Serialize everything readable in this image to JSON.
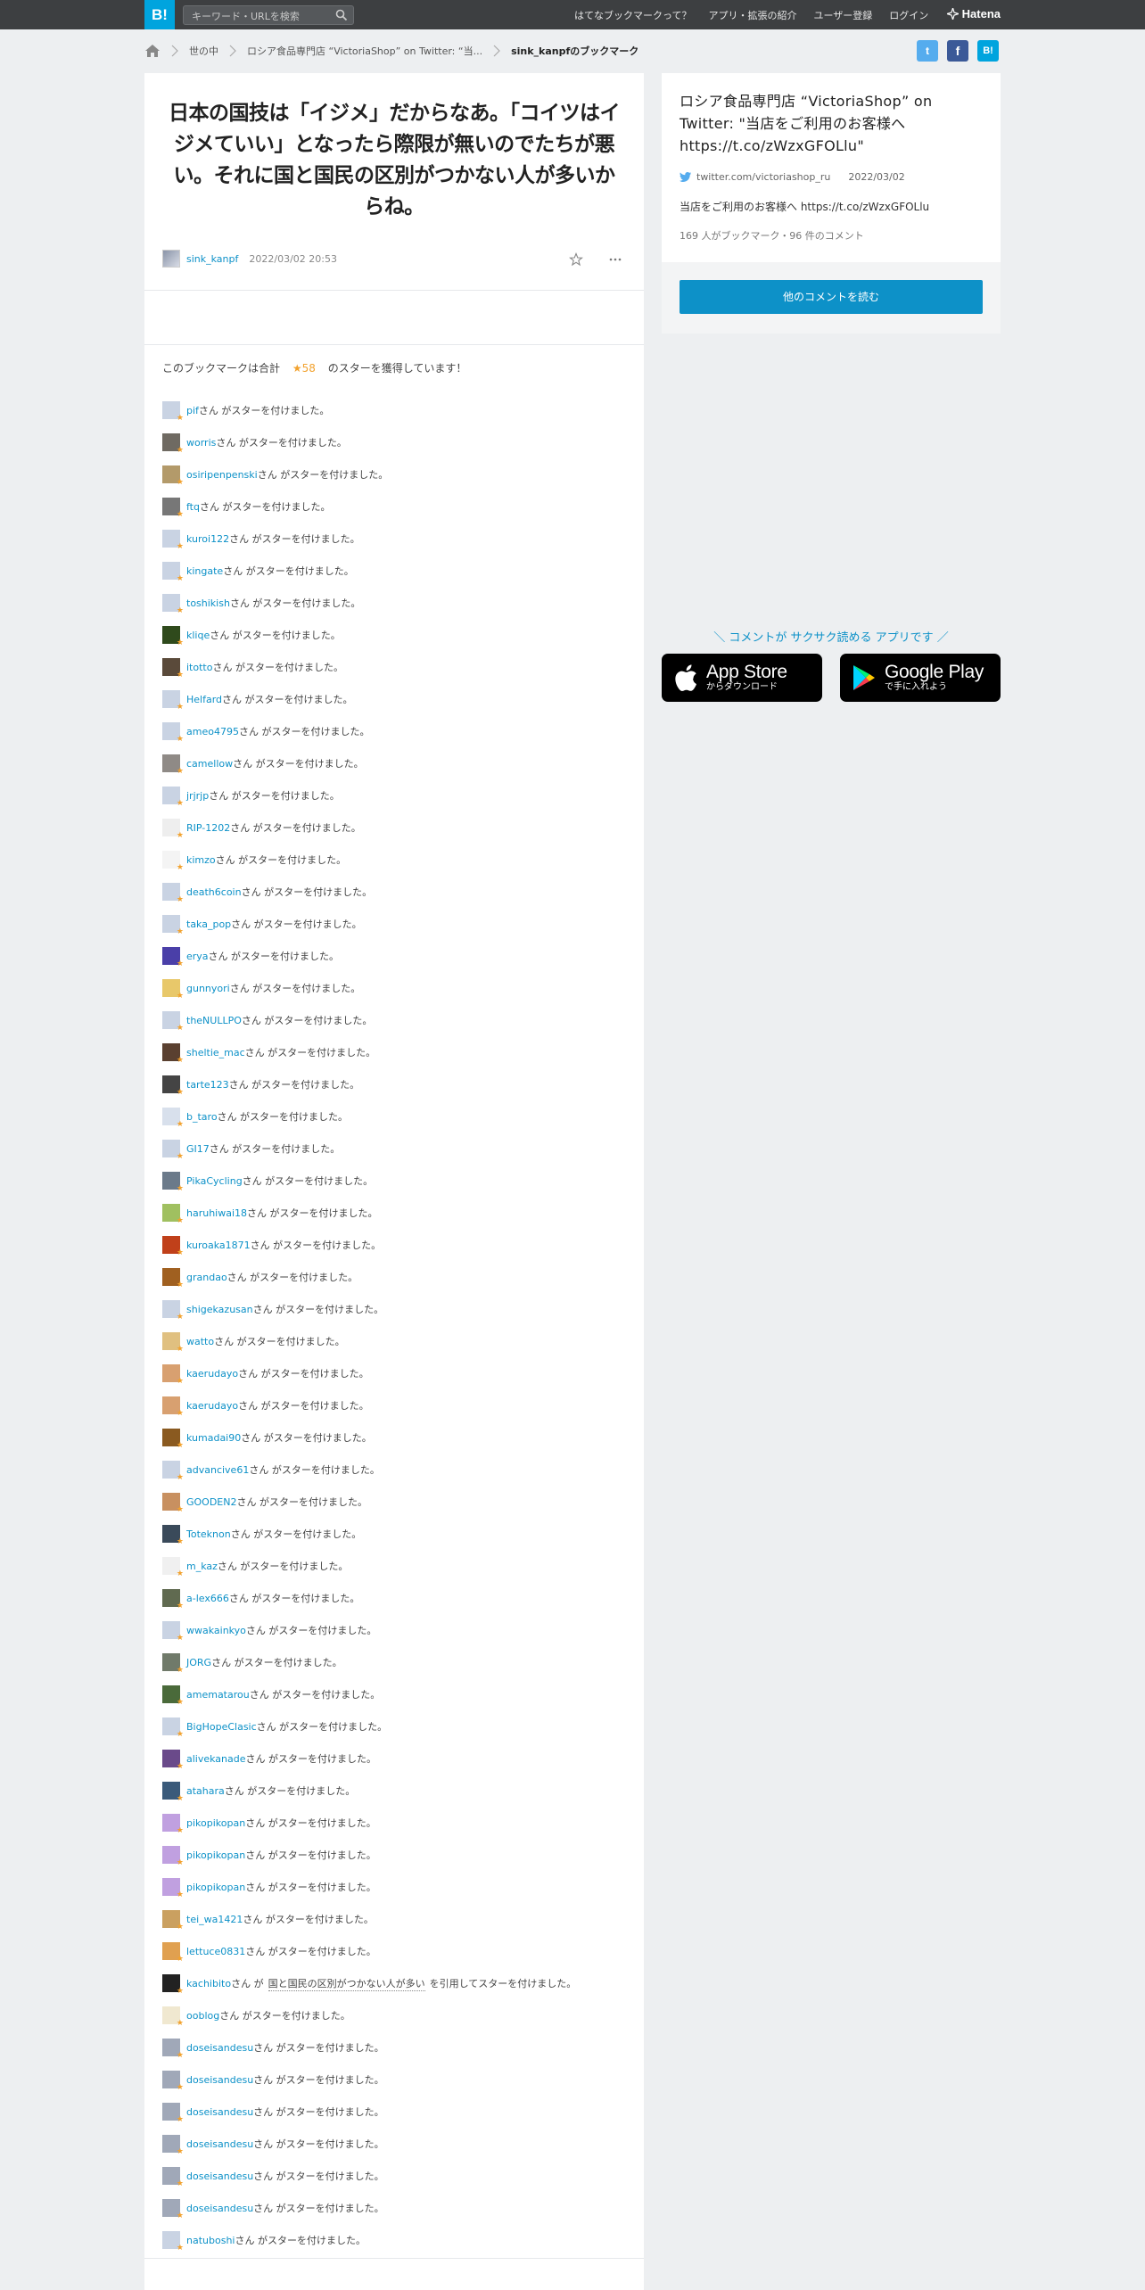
{
  "header": {
    "logo": "B!",
    "search_placeholder": "キーワード・URLを検索",
    "nav": [
      "はてなブックマークって？",
      "アプリ・拡張の紹介",
      "ユーザー登録",
      "ログイン"
    ],
    "brand": "Hatena"
  },
  "breadcrumb": {
    "items": [
      "世の中",
      "ロシア食品専門店 “VictoriaShop” on Twitter: “当...",
      "sink_kanpfのブックマーク"
    ]
  },
  "share": [
    "twitter-icon",
    "facebook-icon",
    "hatena-bookmark-icon"
  ],
  "bookmark": {
    "comment": "日本の国技は「イジメ」だからなあ。「コイツはイジメていい」となったら際限が無いのでたちが悪い。それに国と国民の区別がつかない人が多いからね。",
    "user": "sink_kanpf",
    "date": "2022/03/02 20:53"
  },
  "stars": {
    "summary_prefix": "このブックマークは合計",
    "star_glyph": "★",
    "total": "58",
    "summary_suffix": "のスターを獲得しています！",
    "suffix": "さん がスターを付けました。",
    "quote_suffix_a": "さん が",
    "quote_suffix_b": "を引用してスターを付けました。",
    "users": [
      {
        "name": "pif",
        "color": "#c9d3e3"
      },
      {
        "name": "worris",
        "color": "#6f6a62"
      },
      {
        "name": "osiripenpenski",
        "color": "#b39a6a"
      },
      {
        "name": "ftq",
        "color": "#777777"
      },
      {
        "name": "kuroi122",
        "color": "#c9d3e3"
      },
      {
        "name": "kingate",
        "color": "#c9d3e3"
      },
      {
        "name": "toshikish",
        "color": "#c9d3e3"
      },
      {
        "name": "kliqe",
        "color": "#2f4a1c"
      },
      {
        "name": "itotto",
        "color": "#5a4a3a"
      },
      {
        "name": "Helfard",
        "color": "#c9d3e3"
      },
      {
        "name": "ameo4795",
        "color": "#c9d3e3"
      },
      {
        "name": "camellow",
        "color": "#8f8a86"
      },
      {
        "name": "jrjrjp",
        "color": "#c9d3e3"
      },
      {
        "name": "RIP-1202",
        "color": "#eeeeee"
      },
      {
        "name": "kimzo",
        "color": "#f4f4f4"
      },
      {
        "name": "death6coin",
        "color": "#c9d3e3"
      },
      {
        "name": "taka_pop",
        "color": "#c9d3e3"
      },
      {
        "name": "erya",
        "color": "#4a3fa8"
      },
      {
        "name": "gunnyori",
        "color": "#e8c86a"
      },
      {
        "name": "theNULLPO",
        "color": "#c9d3e3"
      },
      {
        "name": "sheltie_mac",
        "color": "#5a4030"
      },
      {
        "name": "tarte123",
        "color": "#444444"
      },
      {
        "name": "b_taro",
        "color": "#d8e0ec"
      },
      {
        "name": "GI17",
        "color": "#c9d3e3"
      },
      {
        "name": "PikaCycling",
        "color": "#6b7a8a"
      },
      {
        "name": "haruhiwai18",
        "color": "#a0c060"
      },
      {
        "name": "kuroaka1871",
        "color": "#c0401a"
      },
      {
        "name": "grandao",
        "color": "#a06020"
      },
      {
        "name": "shigekazusan",
        "color": "#c9d3e3"
      },
      {
        "name": "watto",
        "color": "#e0c080"
      },
      {
        "name": "kaerudayo",
        "color": "#d8a070"
      },
      {
        "name": "kaerudayo",
        "color": "#d8a070"
      },
      {
        "name": "kumadai90",
        "color": "#8a5a20"
      },
      {
        "name": "advancive61",
        "color": "#c9d3e3"
      },
      {
        "name": "GOODEN2",
        "color": "#c89060"
      },
      {
        "name": "Toteknon",
        "color": "#3a4a5a"
      },
      {
        "name": "m_kaz",
        "color": "#f0f0f0"
      },
      {
        "name": "a-lex666",
        "color": "#606a50"
      },
      {
        "name": "wwakainkyo",
        "color": "#c9d3e3"
      },
      {
        "name": "JORG",
        "color": "#707a6a"
      },
      {
        "name": "amematarou",
        "color": "#4a6a3a"
      },
      {
        "name": "BigHopeClasic",
        "color": "#c9d3e3"
      },
      {
        "name": "alivekanade",
        "color": "#6a4a8a"
      },
      {
        "name": "atahara",
        "color": "#3a5a7a"
      },
      {
        "name": "pikopikopan",
        "color": "#c0a0e0"
      },
      {
        "name": "pikopikopan",
        "color": "#c0a0e0"
      },
      {
        "name": "pikopikopan",
        "color": "#c0a0e0"
      },
      {
        "name": "tei_wa1421",
        "color": "#caa060"
      },
      {
        "name": "lettuce0831",
        "color": "#e0a050"
      }
    ],
    "quote_user": {
      "name": "kachibito",
      "color": "#222222",
      "quote": "国と国民の区別がつかない人が多い"
    },
    "users_after": [
      {
        "name": "ooblog",
        "color": "#f0e8d0"
      },
      {
        "name": "doseisandesu",
        "color": "#a0a8b8"
      },
      {
        "name": "doseisandesu",
        "color": "#a0a8b8"
      },
      {
        "name": "doseisandesu",
        "color": "#a0a8b8"
      },
      {
        "name": "doseisandesu",
        "color": "#a0a8b8"
      },
      {
        "name": "doseisandesu",
        "color": "#a0a8b8"
      },
      {
        "name": "doseisandesu",
        "color": "#a0a8b8"
      },
      {
        "name": "natuboshi",
        "color": "#c9d3e3"
      }
    ]
  },
  "entry": {
    "title": "ロシア食品専門店 “VictoriaShop” on Twitter: \"当店をご利用のお客様へ https://t.co/zWzxGFOLlu\"",
    "source": "twitter.com/victoriashop_ru",
    "date": "2022/03/02",
    "description": "当店をご利用のお客様へ https://t.co/zWzxGFOLlu",
    "count": "169 人がブックマーク・96 件のコメント",
    "button": "他のコメントを読む"
  },
  "apps": {
    "promo": "＼ コメントが サクサク読める アプリです ／",
    "appstore_big": "App Store",
    "appstore_small": "からダウンロード",
    "googleplay_big": "Google Play",
    "googleplay_small": "で手に入れよう"
  },
  "colors": {
    "accent": "#0d91c8",
    "header_bg": "#3d3f41",
    "logo_bg": "#00a4de",
    "star": "#f2a22e",
    "page_bg": "#edeff1"
  }
}
